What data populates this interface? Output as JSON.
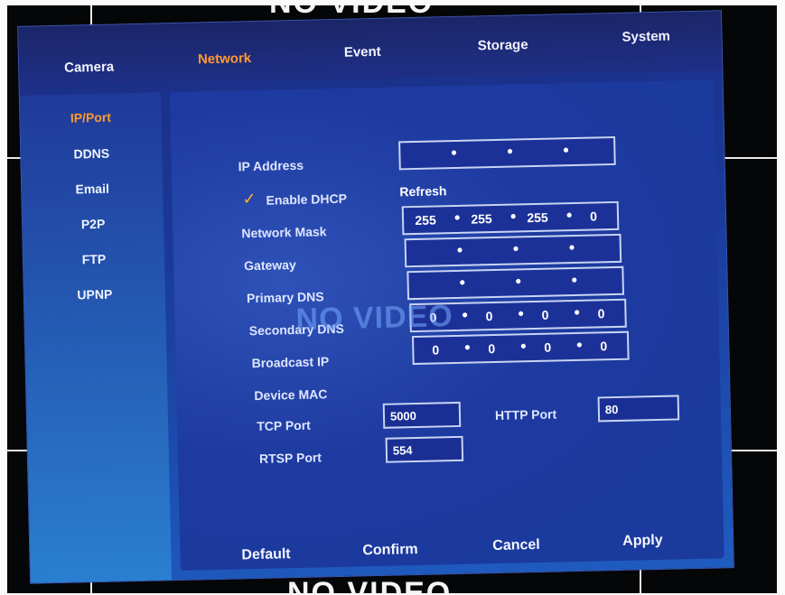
{
  "overlay": {
    "no_video": "NO VIDEO"
  },
  "tabs": [
    {
      "label": "Camera",
      "active": false
    },
    {
      "label": "Network",
      "active": true
    },
    {
      "label": "Event",
      "active": false
    },
    {
      "label": "Storage",
      "active": false
    },
    {
      "label": "System",
      "active": false
    }
  ],
  "sidebar": {
    "items": [
      {
        "label": "IP/Port",
        "active": true
      },
      {
        "label": "DDNS",
        "active": false
      },
      {
        "label": "Email",
        "active": false
      },
      {
        "label": "P2P",
        "active": false
      },
      {
        "label": "FTP",
        "active": false
      },
      {
        "label": "UPNP",
        "active": false
      }
    ]
  },
  "form": {
    "ip_address": {
      "label": "IP Address",
      "octets": [
        "",
        "",
        "",
        ""
      ]
    },
    "dhcp": {
      "label": "Enable DHCP",
      "checked": true
    },
    "refresh_label": "Refresh",
    "network_mask": {
      "label": "Network Mask",
      "octets": [
        "255",
        "255",
        "255",
        "0"
      ]
    },
    "gateway": {
      "label": "Gateway",
      "octets": [
        "",
        "",
        "",
        ""
      ]
    },
    "primary_dns": {
      "label": "Primary DNS",
      "octets": [
        "",
        "",
        "",
        ""
      ]
    },
    "secondary_dns": {
      "label": "Secondary DNS",
      "octets": [
        "0",
        "0",
        "0",
        "0"
      ]
    },
    "broadcast_ip": {
      "label": "Broadcast IP",
      "octets": [
        "0",
        "0",
        "0",
        "0"
      ]
    },
    "device_mac": {
      "label": "Device MAC",
      "value": ""
    },
    "tcp_port": {
      "label": "TCP Port",
      "value": "5000"
    },
    "http_port": {
      "label": "HTTP Port",
      "value": "80"
    },
    "rtsp_port": {
      "label": "RTSP Port",
      "value": "554"
    }
  },
  "buttons": {
    "default": "Default",
    "confirm": "Confirm",
    "cancel": "Cancel",
    "apply": "Apply"
  },
  "colors": {
    "accent": "#ff9a2e",
    "dialog_blue": "#1a3a9a"
  },
  "icons": {
    "dhcp_check": "checkmark-icon"
  }
}
